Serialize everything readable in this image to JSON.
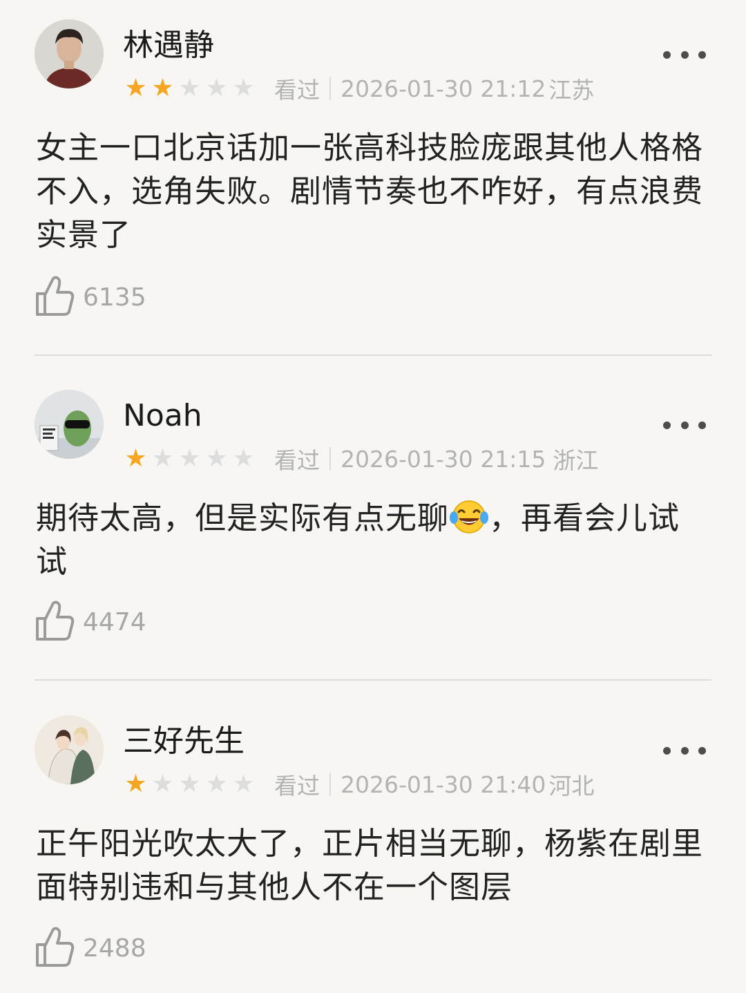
{
  "reviews": [
    {
      "username": "林遇静",
      "rating": 2,
      "stars": [
        "★",
        "★",
        "★",
        "★",
        "★"
      ],
      "status": "看过",
      "timestamp": "2026-01-30 21:12",
      "location": "江苏",
      "content": "女主一口北京话加一张高科技脸庞跟其他人格格不入，选角失败。剧情节奏也不咋好，有点浪费实景了",
      "likes": "6135"
    },
    {
      "username": "Noah",
      "rating": 1,
      "stars": [
        "★",
        "★",
        "★",
        "★",
        "★"
      ],
      "status": "看过",
      "timestamp": "2026-01-30 21:15",
      "location": "浙江",
      "content_before": "期待太高，但是实际有点无聊",
      "content_emoji": "face-with-tears-of-joy",
      "content_after": "，再看会儿试试",
      "likes": "4474"
    },
    {
      "username": "三好先生",
      "rating": 1,
      "stars": [
        "★",
        "★",
        "★",
        "★",
        "★"
      ],
      "status": "看过",
      "timestamp": "2026-01-30 21:40",
      "location": "河北",
      "content": "正午阳光吹太大了，正片相当无聊，杨紫在剧里面特别违和与其他人不在一个图层",
      "likes": "2488"
    }
  ],
  "icons": {
    "more": "more-horizontal-icon",
    "like": "thumbs-up-icon"
  },
  "colors": {
    "star_on": "#f5a623",
    "star_off": "#dddddd",
    "meta_text": "#b3b3b3",
    "background": "#f7f6f2"
  }
}
